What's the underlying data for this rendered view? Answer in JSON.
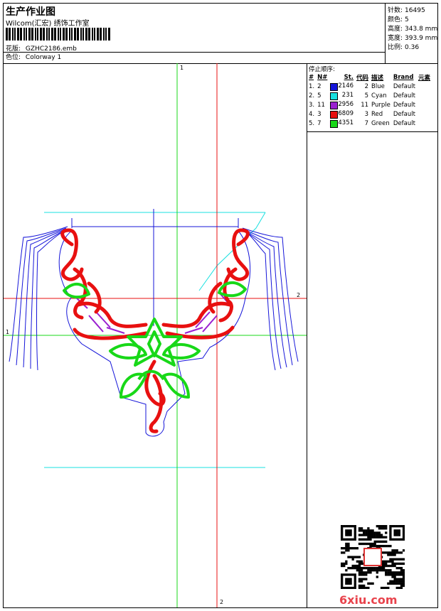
{
  "header": {
    "title": "生产作业图",
    "company": "Wilcom(汇宏) 绣饰工作室",
    "design_label": "花版:",
    "design_value": "GZHC2186.emb",
    "colorway_label": "色位:",
    "colorway_value": "Colorway 1"
  },
  "stats": [
    {
      "label": "针数:",
      "value": "16495"
    },
    {
      "label": "颜色:",
      "value": "5"
    },
    {
      "label": "高度:",
      "value": "343.8 mm"
    },
    {
      "label": "宽度:",
      "value": "393.9 mm"
    },
    {
      "label": "比例:",
      "value": "0.36"
    }
  ],
  "stop_sequence": {
    "title": "停止顺序:",
    "columns": [
      "#",
      "N#",
      "St.",
      "代码",
      "描述",
      "Brand",
      "元素"
    ],
    "rows": [
      {
        "idx": "1.",
        "n": "2",
        "stitches": "2146",
        "code": "2",
        "desc": "Blue",
        "brand": "Default",
        "color": "#1515d9"
      },
      {
        "idx": "2.",
        "n": "5",
        "stitches": "231",
        "code": "5",
        "desc": "Cyan",
        "brand": "Default",
        "color": "#19e0e0"
      },
      {
        "idx": "3.",
        "n": "11",
        "stitches": "2956",
        "code": "11",
        "desc": "Purple",
        "brand": "Default",
        "color": "#9a1fd0"
      },
      {
        "idx": "4.",
        "n": "3",
        "stitches": "6809",
        "code": "3",
        "desc": "Red",
        "brand": "Default",
        "color": "#e81010"
      },
      {
        "idx": "5.",
        "n": "7",
        "stitches": "4351",
        "code": "7",
        "desc": "Green",
        "brand": "Default",
        "color": "#18d818"
      }
    ]
  },
  "axis_labels": {
    "green_top": "1",
    "green_left": "1",
    "red_right": "2",
    "red_bottom": "2"
  },
  "logo": "6xiu.com",
  "colors": {
    "blue": "#1515d9",
    "cyan": "#19e0e0",
    "purple": "#9a1fd0",
    "red": "#e81010",
    "green": "#18d818"
  }
}
